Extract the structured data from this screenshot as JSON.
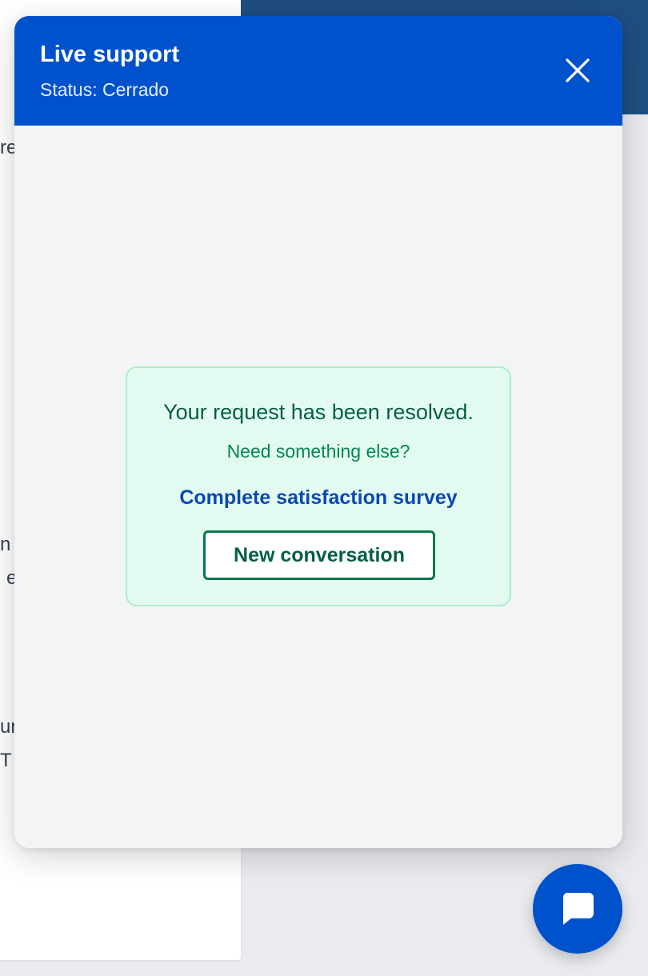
{
  "background": {
    "fragments": [
      "re",
      "n",
      "e",
      "ur",
      "T"
    ]
  },
  "widget": {
    "title": "Live support",
    "status": "Status: Cerrado",
    "close_icon": "close-icon",
    "resolved": {
      "message": "Your request has been resolved.",
      "question": "Need something else?",
      "survey_link": "Complete satisfaction survey",
      "new_conversation_label": "New conversation"
    }
  },
  "launcher": {
    "icon": "chat-bubble-icon"
  },
  "colors": {
    "header": "#0052cc",
    "banner": "#1f4e82",
    "resolved_bg": "#e3faf0",
    "resolved_border": "#abeecb",
    "resolved_text": "#065f46",
    "link": "#0a48b3"
  }
}
